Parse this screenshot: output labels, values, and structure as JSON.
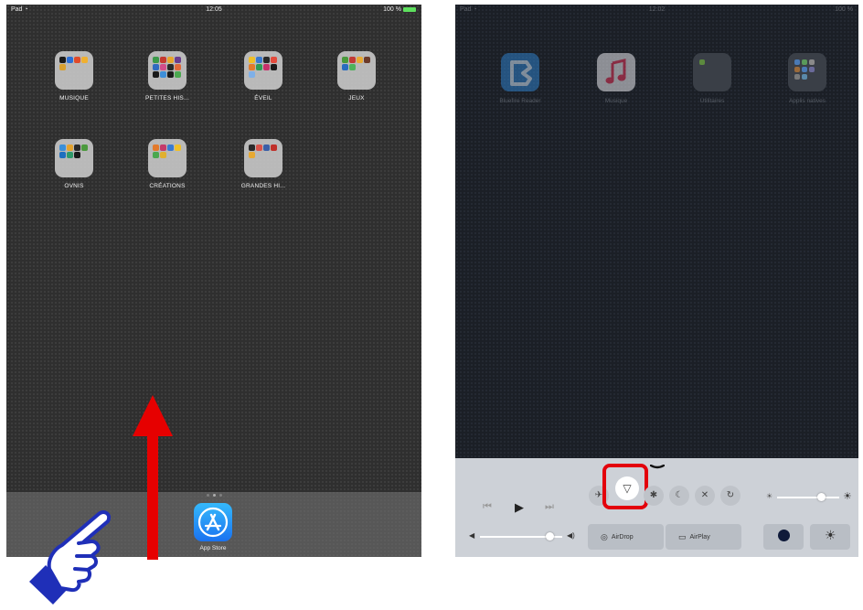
{
  "left_screen": {
    "status": {
      "carrier": "Pad",
      "time": "12:05",
      "battery": "100 %"
    },
    "folders": [
      {
        "label": "MUSIQUE"
      },
      {
        "label": "PETITES HIS..."
      },
      {
        "label": "ÉVEIL"
      },
      {
        "label": "JEUX"
      },
      {
        "label": "OVNIS"
      },
      {
        "label": "CRÉATIONS"
      },
      {
        "label": "GRANDES HI..."
      }
    ],
    "dock": {
      "app_label": "App Store",
      "icon": "app-store-icon"
    },
    "gesture": {
      "arrow_color": "#e60000",
      "hand_color": "#1f2fb8"
    }
  },
  "right_screen": {
    "status": {
      "carrier": "Pad",
      "time": "12:02",
      "battery": "100 %"
    },
    "apps": [
      {
        "label": "Bluefire Reader",
        "color": "#2e7fc9"
      },
      {
        "label": "Musique",
        "color": "#f2f2f4"
      },
      {
        "label": "Utilitaires",
        "color": "#3a3f47"
      },
      {
        "label": "Applis natives",
        "color": "#3a3f47"
      }
    ],
    "control_center": {
      "airdrop_label": "AirDrop",
      "airplay_label": "AirPlay",
      "volume_level": 0.85,
      "brightness_level": 0.72,
      "highlight_color": "#e3000b"
    }
  }
}
